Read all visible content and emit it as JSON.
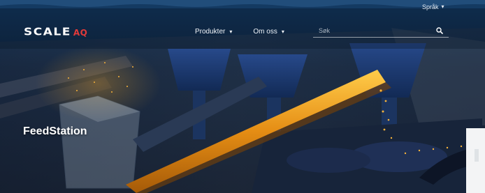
{
  "header": {
    "language_label": "Språk",
    "logo": {
      "word": "SCALE",
      "suffix": "AQ"
    },
    "nav": [
      {
        "label": "Produkter"
      },
      {
        "label": "Om oss"
      }
    ],
    "search": {
      "placeholder": "Søk",
      "value": ""
    }
  },
  "hero": {
    "title": "FeedStation",
    "colors": {
      "feed_pellets": "#f2a41c",
      "machinery": "#1e3a6b",
      "sky": "#0b1a2e"
    }
  },
  "icons": {
    "language_chevron": "chevron-down-icon",
    "nav_chevron": "chevron-down-icon",
    "search": "search-icon"
  }
}
